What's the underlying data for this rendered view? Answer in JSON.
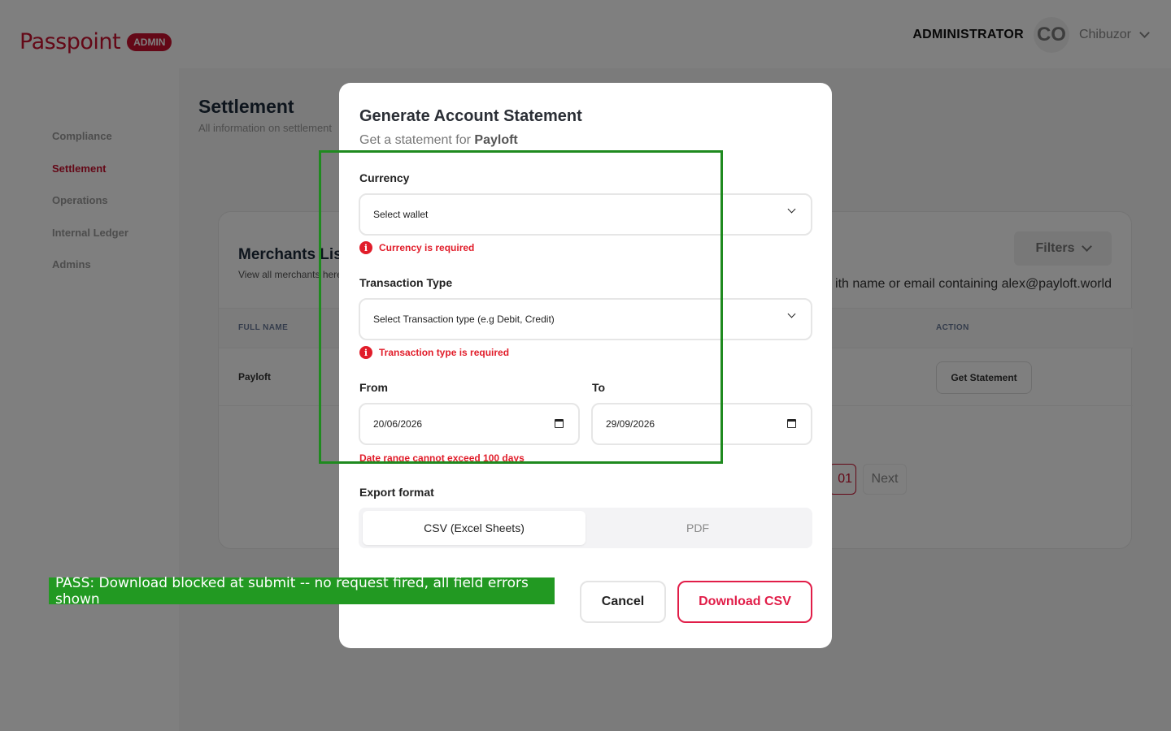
{
  "brand": {
    "name": "Passpoint",
    "badge": "ADMIN"
  },
  "header": {
    "role": "ADMINISTRATOR",
    "avatar_initials": "CO",
    "user_name": "Chibuzor"
  },
  "sidebar": {
    "items": [
      {
        "label": "Compliance",
        "active": false
      },
      {
        "label": "Settlement",
        "active": true
      },
      {
        "label": "Operations",
        "active": false
      },
      {
        "label": "Internal Ledger",
        "active": false
      },
      {
        "label": "Admins",
        "active": false
      }
    ]
  },
  "page": {
    "title": "Settlement",
    "subtitle": "All information on settlement"
  },
  "merchants": {
    "title": "Merchants List",
    "subtitle": "View all merchants here",
    "filters_label": "Filters",
    "search_hint": "ith name or email containing alex@payloft.world",
    "columns": {
      "full_name": "FULL NAME",
      "action": "ACTION"
    },
    "rows": [
      {
        "full_name": "Payloft",
        "action_label": "Get Statement"
      }
    ],
    "pagination": {
      "current": "01",
      "next_label": "Next"
    }
  },
  "modal": {
    "title": "Generate Account Statement",
    "subtitle_prefix": "Get a statement for",
    "merchant": "Payloft",
    "currency": {
      "label": "Currency",
      "value": "Select wallet",
      "error": "Currency is required"
    },
    "transaction_type": {
      "label": "Transaction Type",
      "value": "Select Transaction type (e.g Debit, Credit)",
      "error": "Transaction type is required"
    },
    "from": {
      "label": "From",
      "value": "20/06/2026"
    },
    "to": {
      "label": "To",
      "value": "29/09/2026"
    },
    "date_error": "Date range cannot exceed 100 days",
    "export_format": {
      "label": "Export format",
      "options": [
        "CSV (Excel Sheets)",
        "PDF"
      ],
      "selected": "CSV (Excel Sheets)"
    },
    "cancel_label": "Cancel",
    "download_label": "Download CSV"
  },
  "test_banner": {
    "text": "PASS: Download blocked at submit -- no request fired, all field errors shown"
  },
  "colors": {
    "brand": "#c8102e",
    "error": "#e11d2a",
    "pass": "#229922"
  }
}
